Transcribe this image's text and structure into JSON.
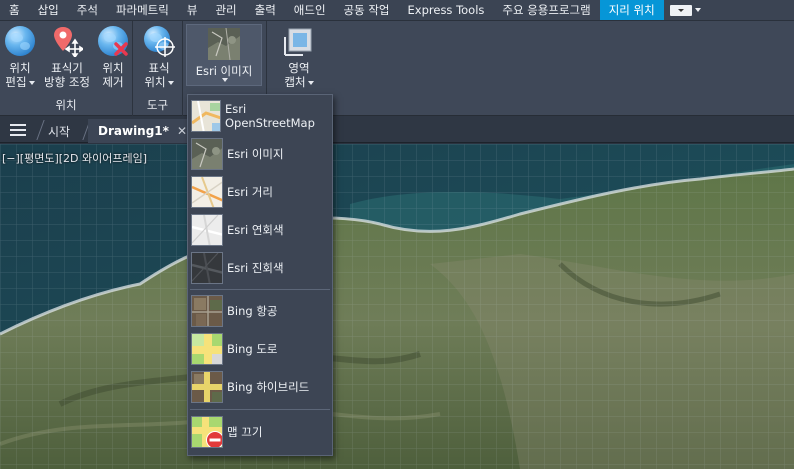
{
  "ribbon_tabs": [
    "홈",
    "삽입",
    "주석",
    "파라메트릭",
    "뷰",
    "관리",
    "출력",
    "애드인",
    "공동 작업",
    "Express Tools",
    "주요 응용프로그램",
    "지리 위치"
  ],
  "active_tab": "지리 위치",
  "panels": {
    "location": {
      "title": "위치",
      "edit": [
        "위치",
        "편집"
      ],
      "mark": [
        "표식기",
        "방향 조정"
      ],
      "remove": [
        "위치",
        "제거"
      ]
    },
    "tools": {
      "title": "도구",
      "mark_position": [
        "표식",
        "위치"
      ]
    },
    "online_map": {
      "label": "Esri 이미지"
    },
    "capture": {
      "label": [
        "영역",
        "캡처"
      ]
    }
  },
  "doc_tabs": {
    "start": "시작",
    "drawing": "Drawing1*"
  },
  "viewport_label": "[−][평면도][2D 와이어프레임]",
  "map_menu": [
    {
      "label": "Esri OpenStreetMap",
      "icon": "osm-map-thumbnail-icon"
    },
    {
      "label": "Esri 이미지",
      "icon": "imagery-thumbnail-icon"
    },
    {
      "label": "Esri 거리",
      "icon": "street-map-thumbnail-icon"
    },
    {
      "label": "Esri 연회색",
      "icon": "light-gray-thumbnail-icon"
    },
    {
      "label": "Esri 진회색",
      "icon": "dark-gray-thumbnail-icon"
    },
    {
      "label": "Bing 항공",
      "icon": "aerial-thumbnail-icon"
    },
    {
      "label": "Bing 도로",
      "icon": "road-thumbnail-icon"
    },
    {
      "label": "Bing 하이브리드",
      "icon": "hybrid-thumbnail-icon"
    },
    {
      "label": "맵 끄기",
      "icon": "map-off-icon"
    }
  ],
  "colors": {
    "accent": "#0696d7",
    "ribbon": "#3f4858",
    "tabbar": "#3b4453"
  }
}
